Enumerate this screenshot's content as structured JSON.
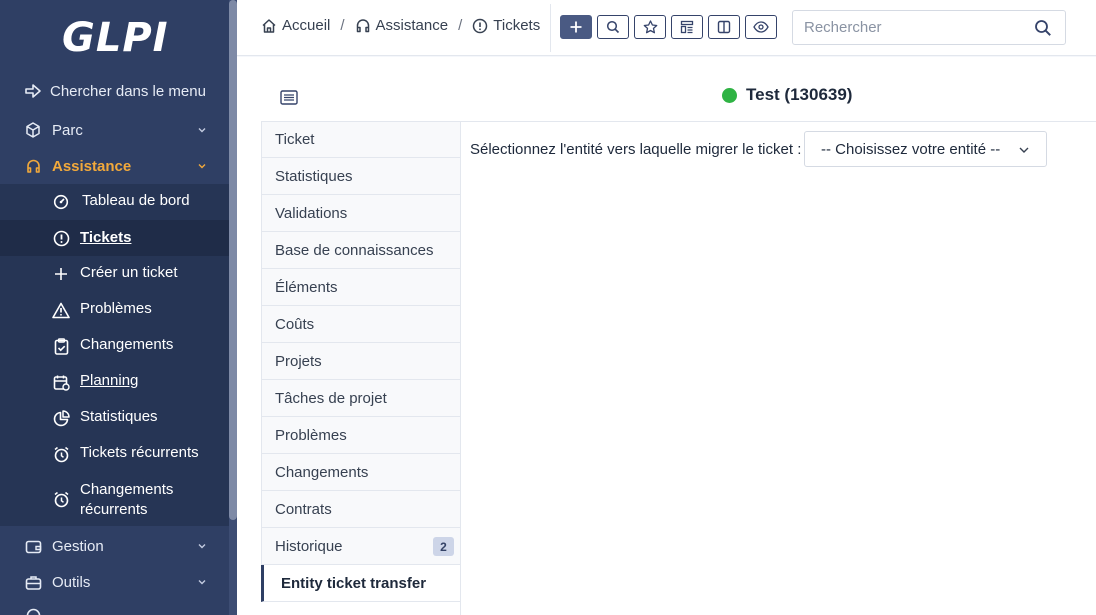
{
  "app": {
    "logo_text": "GLPI"
  },
  "sidebar": {
    "search_label": "Chercher dans le menu",
    "items": [
      {
        "label": "Parc",
        "icon": "cube-icon"
      },
      {
        "label": "Assistance",
        "icon": "headset-icon",
        "active": true
      },
      {
        "label": "Gestion",
        "icon": "wallet-icon"
      },
      {
        "label": "Outils",
        "icon": "briefcase-icon"
      }
    ],
    "assistance_sub": [
      {
        "label": "Tableau de bord",
        "icon": "dashboard-icon"
      },
      {
        "label": "Tickets",
        "icon": "alert-circle-icon",
        "current": true
      },
      {
        "label": "Créer un ticket",
        "icon": "plus-icon"
      },
      {
        "label": "Problèmes",
        "icon": "alert-triangle-icon"
      },
      {
        "label": "Changements",
        "icon": "clipboard-check-icon"
      },
      {
        "label": "Planning",
        "icon": "calendar-icon"
      },
      {
        "label": "Statistiques",
        "icon": "chart-pie-icon"
      },
      {
        "label": "Tickets récurrents",
        "icon": "alarm-icon"
      },
      {
        "label": "Changements récurrents",
        "line1": "Changements",
        "line2": "récurrents",
        "icon": "alarm-icon"
      }
    ]
  },
  "breadcrumb": {
    "home": "Accueil",
    "section": "Assistance",
    "page": "Tickets"
  },
  "toolbar": {
    "buttons": [
      "add-icon",
      "search-icon",
      "star-icon",
      "layout-icon",
      "columns-icon",
      "eye-icon"
    ]
  },
  "search": {
    "placeholder": "Rechercher"
  },
  "ticket": {
    "title": "Test (130639)",
    "status_color": "#2fb344"
  },
  "tabs": [
    {
      "label": "Ticket"
    },
    {
      "label": "Statistiques"
    },
    {
      "label": "Validations"
    },
    {
      "label": "Base de connaissances"
    },
    {
      "label": "Éléments"
    },
    {
      "label": "Coûts"
    },
    {
      "label": "Projets"
    },
    {
      "label": "Tâches de projet"
    },
    {
      "label": "Problèmes"
    },
    {
      "label": "Changements"
    },
    {
      "label": "Contrats"
    },
    {
      "label": "Historique",
      "badge": "2"
    },
    {
      "label": "Entity ticket transfer",
      "active": true
    }
  ],
  "transfer": {
    "label": "Sélectionnez l'entité vers laquelle migrer le ticket :",
    "select_value": "-- Choisissez votre entité --"
  },
  "colors": {
    "sidebar_bg": "#2f3f64",
    "accent": "#f2a93b",
    "primary": "#4a5a83"
  }
}
